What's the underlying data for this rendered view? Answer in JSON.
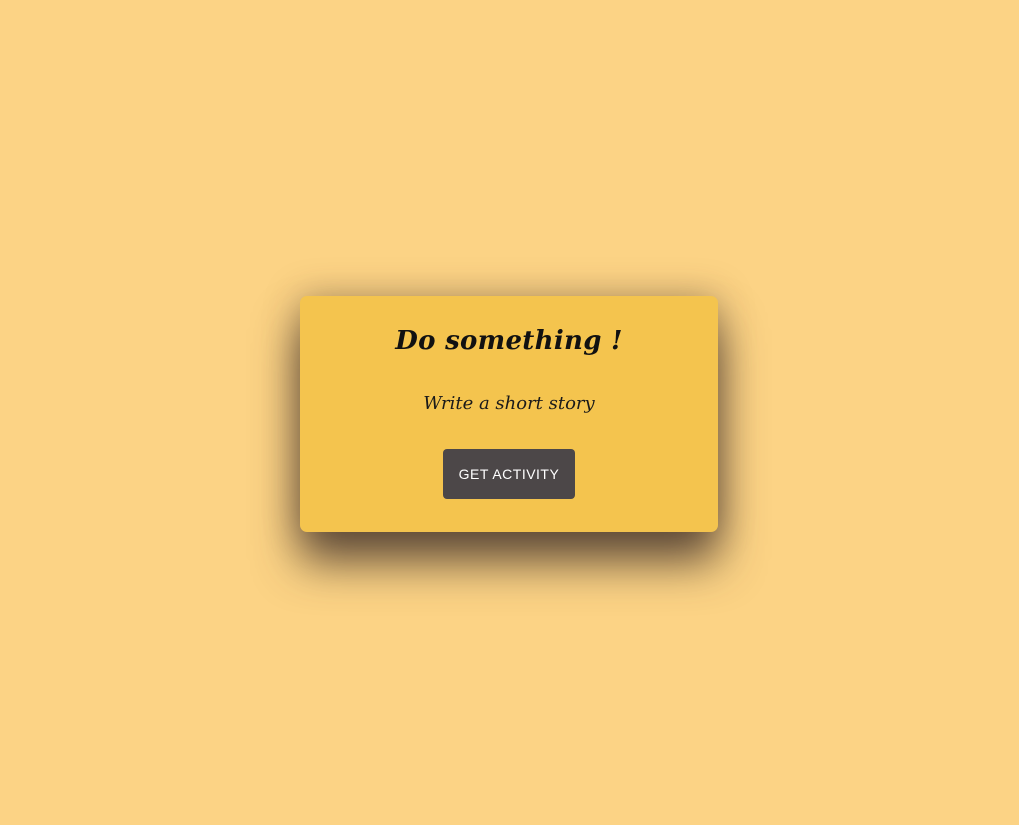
{
  "card": {
    "title": "Do something !",
    "activity": "Write a short story",
    "button_label": "GET ACTIVITY"
  },
  "colors": {
    "page_background": "#fcd385",
    "card_background": "#f4c44e",
    "button_background": "#4c4748",
    "button_text": "#ffffff",
    "text": "#111111"
  }
}
